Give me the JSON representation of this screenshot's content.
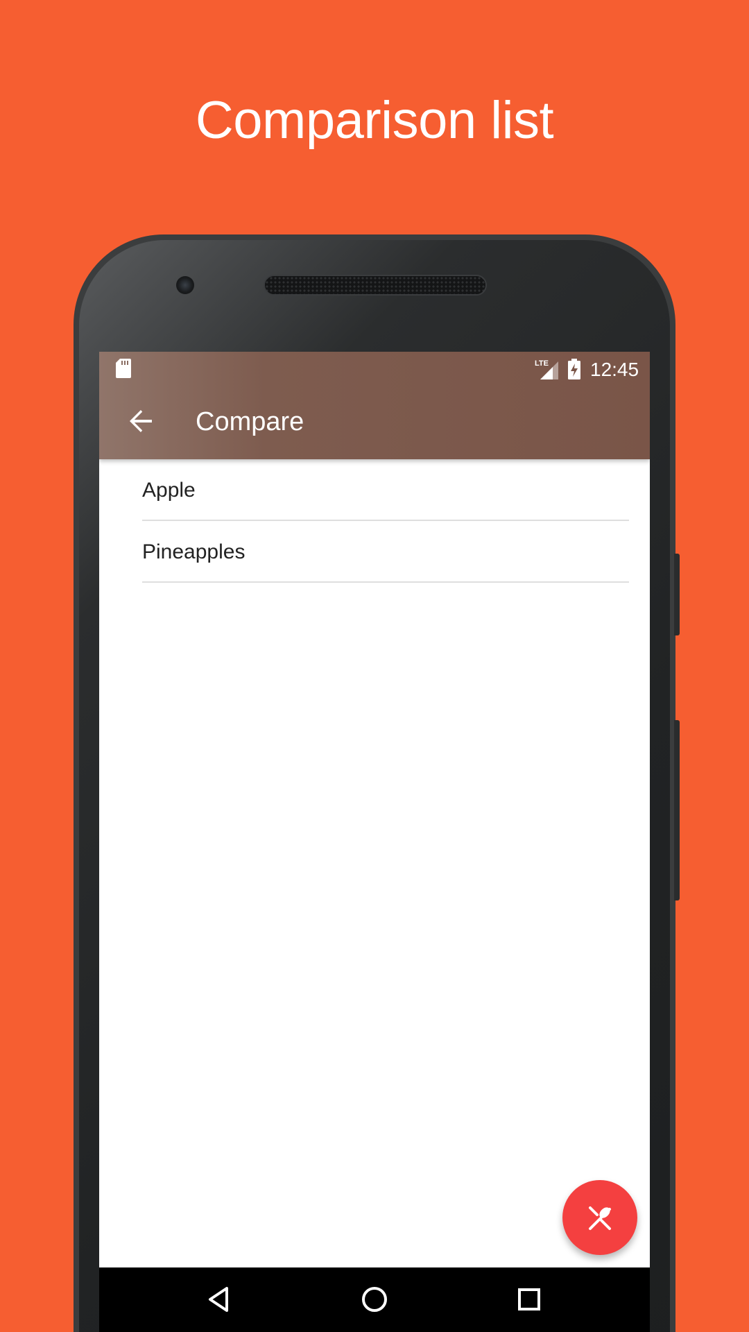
{
  "promo": {
    "headline": "Comparison list"
  },
  "status_bar": {
    "time": "12:45",
    "network": "LTE",
    "icons": [
      "sd-card-icon",
      "lte-signal-icon",
      "battery-charging-icon"
    ]
  },
  "app_bar": {
    "title": "Compare",
    "back_icon": "arrow-back-icon",
    "color": "#7a5548"
  },
  "list": {
    "items": [
      {
        "label": "Apple"
      },
      {
        "label": "Pineapples"
      }
    ]
  },
  "fab": {
    "icon": "utensils-icon",
    "color": "#f44040"
  },
  "nav_bar": {
    "buttons": [
      "back-triangle-icon",
      "home-circle-icon",
      "recents-square-icon"
    ]
  },
  "colors": {
    "background": "#f65e31",
    "accent": "#f44040"
  }
}
